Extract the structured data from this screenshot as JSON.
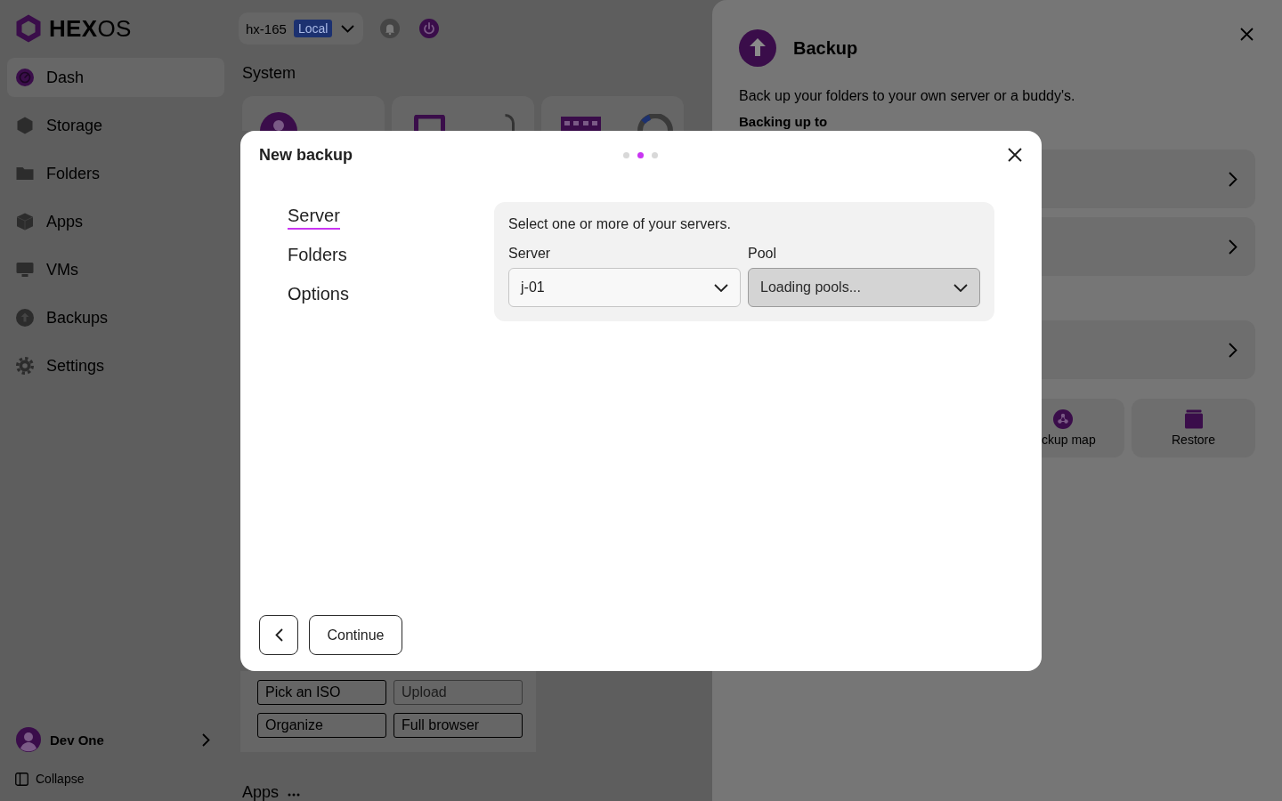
{
  "sidebar": {
    "logo": "**HEX**OS",
    "nav_items": [
      {
        "label": "Dash",
        "selected": true
      },
      {
        "label": "Storage",
        "selected": false
      },
      {
        "label": "Folders",
        "selected": false
      },
      {
        "label": "Apps",
        "selected": false
      },
      {
        "label": "VMs",
        "selected": false
      },
      {
        "label": "Backups",
        "selected": false
      },
      {
        "label": "Settings",
        "selected": false
      }
    ],
    "user_name": "Dev One",
    "collapse_label": "Collapse"
  },
  "header": {
    "server_name": "hx-165",
    "server_badge": "Local"
  },
  "system": {
    "title": "System"
  },
  "files_card": {
    "buttons": [
      {
        "label": "Pick an ISO",
        "disabled": false
      },
      {
        "label": "Upload",
        "disabled": true
      },
      {
        "label": "Organize",
        "disabled": false
      },
      {
        "label": "Full browser",
        "disabled": false
      }
    ]
  },
  "apps_section": {
    "title": "Apps"
  },
  "drawer": {
    "title": "Backup",
    "description": "Back up your folders to your own server or a buddy's.",
    "section_title": "Backing up to",
    "tiles": [
      {
        "label": "ckup map"
      },
      {
        "label": "Restore"
      }
    ]
  },
  "dialog": {
    "title": "New backup",
    "step_dots": [
      {
        "selected": false
      },
      {
        "selected": true
      },
      {
        "selected": false
      }
    ],
    "steps": [
      {
        "label": "Server",
        "selected": true
      },
      {
        "label": "Folders",
        "selected": false
      },
      {
        "label": "Options",
        "selected": false
      }
    ],
    "prompt": "Select one or more of your servers.",
    "fields": [
      {
        "label": "Server",
        "value": "j-01",
        "disabled": false
      },
      {
        "label": "Pool",
        "value": "Loading pools...",
        "disabled": true
      }
    ],
    "continue_label": "Continue"
  }
}
